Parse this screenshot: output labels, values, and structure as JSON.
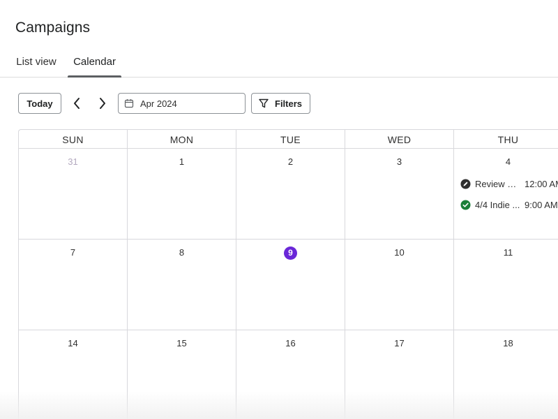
{
  "page": {
    "title": "Campaigns"
  },
  "tabs": [
    {
      "label": "List view",
      "selected": false
    },
    {
      "label": "Calendar",
      "selected": true
    }
  ],
  "toolbar": {
    "today_label": "Today",
    "prev_icon": "chevron-left-icon",
    "next_icon": "chevron-right-icon",
    "date_value": "Apr 2024",
    "filters_label": "Filters"
  },
  "calendar": {
    "weekdays": [
      "SUN",
      "MON",
      "TUE",
      "WED",
      "THU"
    ],
    "weeks": [
      [
        "31",
        "1",
        "2",
        "3",
        "4"
      ],
      [
        "7",
        "8",
        "9",
        "10",
        "11"
      ],
      [
        "14",
        "15",
        "16",
        "17",
        "18"
      ]
    ],
    "today_day": "9",
    "outside_month_days": [
      "31"
    ],
    "events": [
      {
        "day": "4",
        "title": "Review R...",
        "time": "12:00 AM",
        "status": "draft",
        "icon": "pencil-icon",
        "color": "#303030"
      },
      {
        "day": "4",
        "title": "4/4 Indie ...",
        "time": "9:00 AM",
        "status": "sent",
        "icon": "check-circle-icon",
        "color": "#1a7f37"
      }
    ]
  },
  "colors": {
    "today_accent": "#6a27d8",
    "grid_line": "#d8d8dc",
    "sent_green": "#1a7f37"
  }
}
